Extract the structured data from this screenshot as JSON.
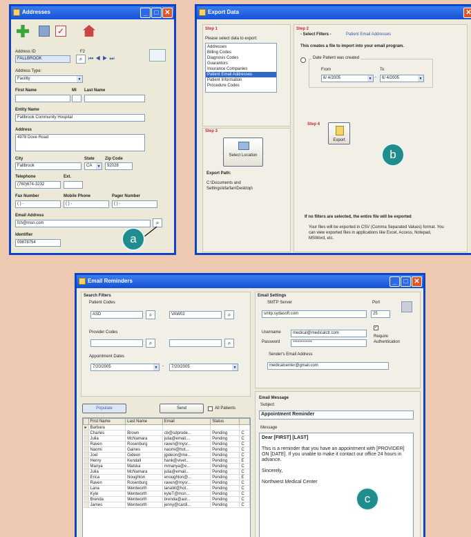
{
  "callouts": {
    "a": "a",
    "b": "b",
    "c": "c"
  },
  "addresses": {
    "title": "Addresses",
    "address_id_label": "Address ID",
    "address_id": "FALLBROOK",
    "nav_label": "F2",
    "address_type_label": "Address Type:",
    "address_type": "Facility",
    "first_name_label": "First Name",
    "mi_label": "MI",
    "last_name_label": "Last Name",
    "entity_name_label": "Entity Name",
    "entity_name": "Fallbrook Community Hospital",
    "address_label": "Address",
    "address": "4978 Dove Road",
    "city_label": "City",
    "city": "Fallbrook",
    "state_label": "State",
    "state": "CA",
    "zip_label": "Zip Code",
    "zip": "92028",
    "telephone_label": "Telephone",
    "telephone": "(760)674-3232",
    "ext_label": "Ext.",
    "fax_label": "Fax Number",
    "mobile_label": "Mobile Phone",
    "pager_label": "Pager Number",
    "phone_mask": "(   )   -",
    "email_label": "Email Address",
    "email": "fch@msn.com",
    "identifier_label": "Identifier",
    "identifier": "09878754"
  },
  "export": {
    "title": "Export Data",
    "step1": "Step 1",
    "select_prompt": "Please select data to export:",
    "list": [
      "Addresses",
      "Billing Codes",
      "Diagnosis Codes",
      "Guarantors",
      "Insurance Companies",
      "Patient Email Addresses",
      "Patient Information",
      "Procedure Codes"
    ],
    "selected_index": 5,
    "step2": "Step 2",
    "filters_label": "- Select Filters -",
    "filters_value": "Patient Email Addresses",
    "creates_note": "This creates a file to import into your email program.",
    "date_option": "Date Patient was created",
    "from_label": "From",
    "to_label": "To",
    "from_date": "6/ 4/2005",
    "to_date": "6/ 4/2005",
    "step3": "Step 3",
    "select_location": "Select Location",
    "step4": "Step 4",
    "export_button": "Export",
    "export_path_label": "Export Path:",
    "export_path": "C:\\Documents and Settings\\kfarfan\\Desktop\\",
    "no_filters_note": "If no filters are selected, the entire file will be exported",
    "csv_note": "Your files will be exported in CSV (Comma Separated Values) format. You can view exported files in applications like Excel, Access, Notepad, MSWord, etc."
  },
  "email": {
    "title": "Email Reminders",
    "search_filters": "Search Filters",
    "patient_codes": "Patient Codes",
    "patient_from": "ASD",
    "patient_to": "VAW02",
    "provider_codes": "Provider Codes",
    "appointment_dates": "Appointment Dates",
    "date_from": "7/20/2005",
    "date_to": "7/20/2005",
    "populate": "Populate",
    "send": "Send",
    "all_patients": "All Patients",
    "columns": [
      "First Name",
      "Last Name",
      "Email",
      "Status"
    ],
    "rows": [
      [
        "Barbara",
        "",
        "",
        "",
        ""
      ],
      [
        "Charles",
        "Brown",
        "cb@sdprode...",
        "Pending",
        "C"
      ],
      [
        "Julia",
        "McNamara",
        "julia@email....",
        "Pending",
        "C"
      ],
      [
        "Raven",
        "Rosenburg",
        "raven@mysr...",
        "Pending",
        "C"
      ],
      [
        "Naomi",
        "Gaines",
        "naomi@hot...",
        "Pending",
        "C"
      ],
      [
        "Joel",
        "Gideon",
        "jgideon@me...",
        "Pending",
        "C"
      ],
      [
        "Henry",
        "Kendall",
        "hank@vivet...",
        "Pending",
        "E"
      ],
      [
        "Manya",
        "Matska",
        "mmanya@e...",
        "Pending",
        "C"
      ],
      [
        "Julia",
        "McNamara",
        "julia@email...",
        "Pending",
        "C"
      ],
      [
        "Erica",
        "Noughton",
        "enoughton@...",
        "Pending",
        "E"
      ],
      [
        "Raven",
        "Rosenburg",
        "raven@mysr...",
        "Pending",
        "C"
      ],
      [
        "Lana",
        "Wentworth",
        "lanaW@hot...",
        "Pending",
        "C"
      ],
      [
        "Kyle",
        "Wentworth",
        "kyleT@msn...",
        "Pending",
        "C"
      ],
      [
        "Brenda",
        "Wentworth",
        "brenda@aol...",
        "Pending",
        "C"
      ],
      [
        "James",
        "Wentworth",
        "jenny@cardi...",
        "Pending",
        "C"
      ]
    ],
    "email_settings": "Email Settings",
    "smtp_label": "SMTP Server",
    "smtp": "smtp.sydasoft.com",
    "port_label": "Port",
    "port": "25",
    "username_label": "Username",
    "username": "medical@medicalctr.com",
    "password_label": "Password",
    "password": "************",
    "require_auth": "Require Authentication",
    "sender_label": "Sender's Email Address",
    "sender": "medicalcenter@gmail.com",
    "email_message": "Email Message",
    "subject_label": "Subject",
    "subject": "Appointment Reminder",
    "message_label": "Message",
    "msg_greeting": "Dear [FIRST] [LAST]",
    "msg_body": "This is a reminder that you have an appointment with [PROVIDER] ON [DATE]. If you unable to make it contact our office 24 hours in advance.",
    "msg_sincerely": "Sincerely,",
    "msg_sign": "Northwest Medical Center"
  }
}
